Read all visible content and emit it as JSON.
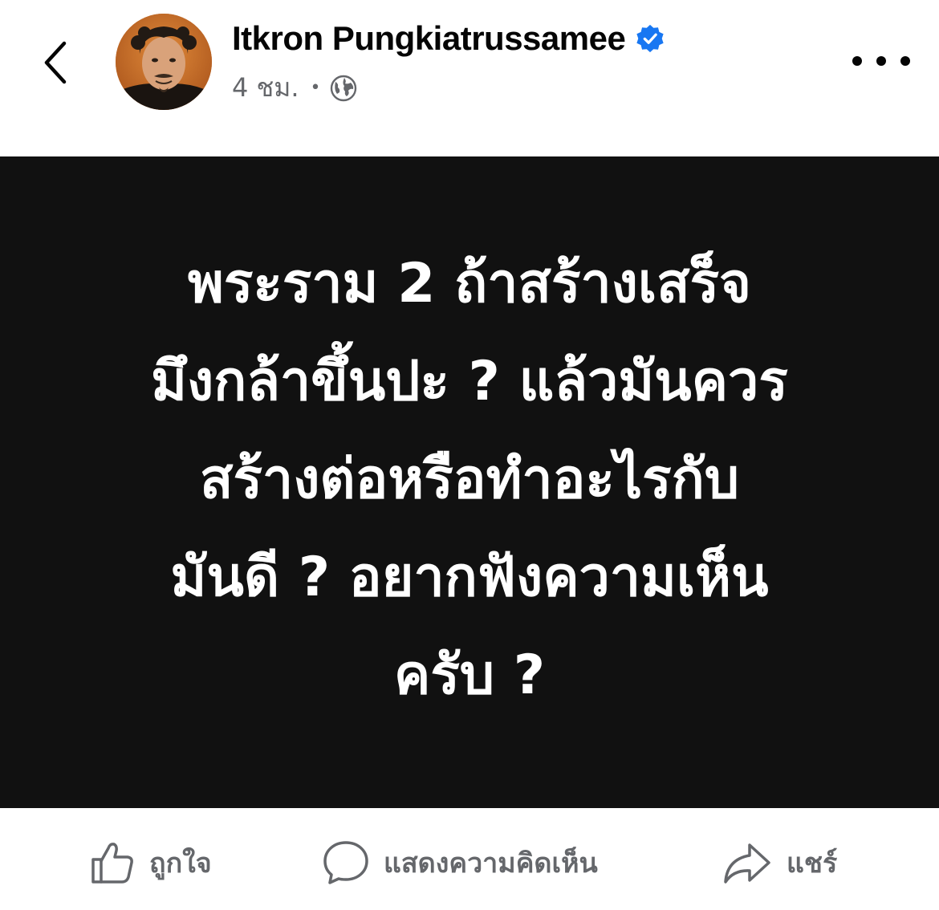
{
  "header": {
    "author": "Itkron Pungkiatrussamee",
    "time": "4 ชม.",
    "separator": "•"
  },
  "post": {
    "lines": [
      "พระราม 2 ถ้าสร้างเสร็จ",
      "มึงกล้าขึ้นปะ ? แล้วมันควร",
      "สร้างต่อหรือทำอะไรกับ",
      "มันดี ? อยากฟังความเห็น",
      "ครับ ?"
    ]
  },
  "actions": {
    "like": "ถูกใจ",
    "comment": "แสดงความคิดเห็น",
    "share": "แชร์"
  },
  "icons": {
    "back": "chevron-left-icon",
    "verified": "verified-badge-icon",
    "audience": "globe-icon",
    "more": "more-dots-icon",
    "like": "thumbs-up-icon",
    "comment": "comment-bubble-icon",
    "share": "share-arrow-icon"
  },
  "colors": {
    "verified_blue": "#1877F2",
    "secondary_text": "#65676B",
    "post_background": "#111111"
  }
}
